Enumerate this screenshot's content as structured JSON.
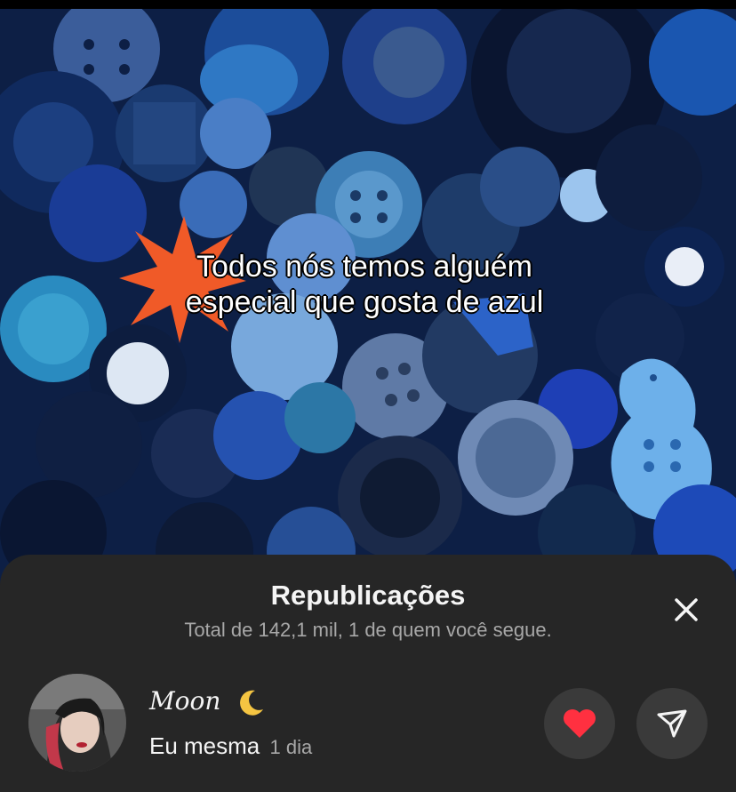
{
  "post": {
    "caption_line1": "Todos nós temos alguém",
    "caption_line2": "especial que gosta de azul",
    "image_description": "pile of blue buttons",
    "burst_color": "#f05a28"
  },
  "reposts_sheet": {
    "title": "Republicações",
    "subtitle": "Total de 142,1 mil, 1 de quem você segue.",
    "close_icon": "close-icon"
  },
  "repost_item": {
    "username": "Moon",
    "username_emoji": "moon-icon",
    "note": "Eu mesma",
    "time": "1 dia",
    "like_icon": "heart-icon",
    "like_color": "#ff3040",
    "send_icon": "paper-plane-icon"
  }
}
